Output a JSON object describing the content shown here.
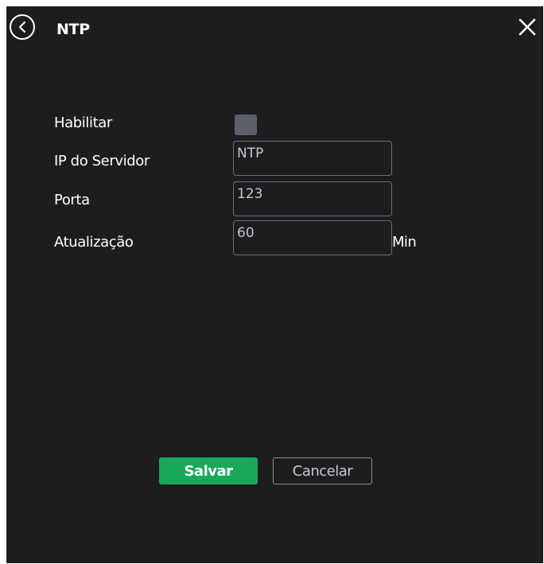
{
  "header": {
    "title": "NTP",
    "back_icon": "chevron-left-circle-icon",
    "close_icon": "close-icon"
  },
  "form": {
    "enable_label": "Habilitar",
    "enable_checked": false,
    "server_label": "IP do Servidor",
    "server_value": "NTP",
    "port_label": "Porta",
    "port_value": "123",
    "update_label": "Atualização",
    "update_value": "60",
    "update_unit": "Min"
  },
  "actions": {
    "save_label": "Salvar",
    "cancel_label": "Cancelar"
  },
  "colors": {
    "background": "#1c1d1f",
    "accent": "#1aa85a",
    "field_border": "#6b6e72"
  }
}
